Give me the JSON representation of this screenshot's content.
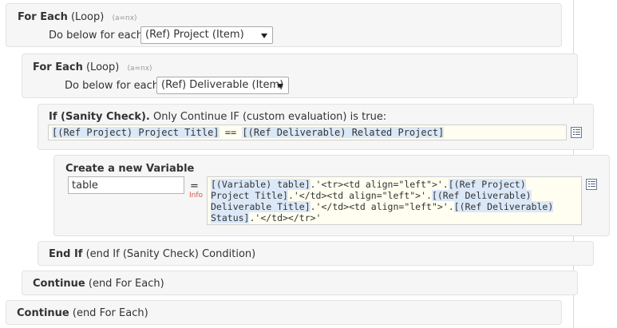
{
  "loop1": {
    "title": "For Each",
    "type": "(Loop)",
    "hint": "(a=nx)",
    "label": "Do below for each",
    "selected": "(Ref) Project (Item)"
  },
  "loop2": {
    "title": "For Each",
    "type": "(Loop)",
    "hint": "(a=nx)",
    "label": "Do below for each",
    "selected": "(Ref) Deliverable (Item)"
  },
  "if_block": {
    "title": "If (Sanity Check).",
    "desc": "Only Continue IF (custom evaluation) is true:",
    "expr_ref1": "[(Ref Project) Project Title]",
    "expr_op": " == ",
    "expr_ref2": "[(Ref Deliverable) Related Project]"
  },
  "variable": {
    "title": "Create a new Variable",
    "name_value": "table",
    "equals": "=",
    "info": "Info",
    "code": {
      "line1_a": "[(Variable) table]",
      "line1_b": ".'<tr><td align=\"left\">'.",
      "line1_c": "[(Ref Project)",
      "line2_a": "Project Title]",
      "line2_b": ".'</td><td align=\"left\">'.",
      "line2_c": "[(Ref Deliverable)",
      "line3_a": "Deliverable Title]",
      "line3_b": ".'</td><td align=\"left\">'.",
      "line3_c": "[(Ref Deliverable)",
      "line4_a": "Status]",
      "line4_b": ".'</td></tr>'"
    }
  },
  "end_if": {
    "title": "End If",
    "desc": "(end If (Sanity Check) Condition)"
  },
  "continue2": {
    "title": "Continue",
    "desc": "(end For Each)"
  },
  "continue1": {
    "title": "Continue",
    "desc": "(end For Each)"
  },
  "icons": {
    "edit": "list-edit-icon",
    "dropdown": "chevron-down-icon"
  }
}
